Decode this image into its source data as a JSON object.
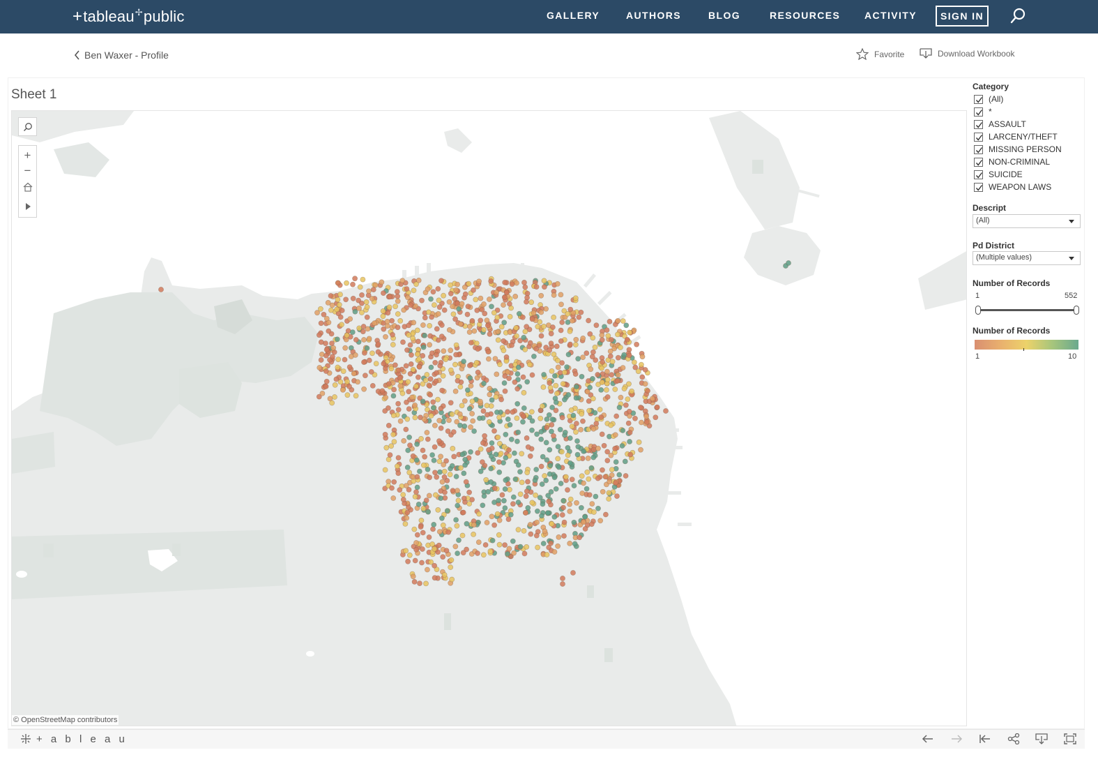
{
  "nav": {
    "logo": "tableau",
    "logo_suffix": "public",
    "items": [
      "GALLERY",
      "AUTHORS",
      "BLOG",
      "RESOURCES",
      "ACTIVITY"
    ],
    "sign_in": "SIGN IN"
  },
  "subheader": {
    "back_label": "Ben Waxer - Profile",
    "favorite_label": "Favorite",
    "download_label": "Download Workbook"
  },
  "sheet": {
    "title": "Sheet 1",
    "attribution": "© OpenStreetMap contributors"
  },
  "filters": {
    "category": {
      "title": "Category",
      "options": [
        "(All)",
        "*",
        "ASSAULT",
        "LARCENY/THEFT",
        "MISSING PERSON",
        "NON-CRIMINAL",
        "SUICIDE",
        "WEAPON LAWS"
      ],
      "checked": [
        true,
        true,
        true,
        true,
        true,
        true,
        true,
        true
      ]
    },
    "descript": {
      "title": "Descript",
      "value": "(All)"
    },
    "pd_district": {
      "title": "Pd District",
      "value": "(Multiple values)"
    },
    "records_range": {
      "title": "Number of Records",
      "min": "1",
      "max": "552",
      "low": 1,
      "high": 552
    },
    "color_legend": {
      "title": "Number of Records",
      "min": "1",
      "max": "10"
    }
  },
  "colors": {
    "nav_bg": "#2c4a66",
    "point_low": "#d17a5c",
    "point_mid": "#e8c460",
    "point_high": "#5f9e86",
    "land": "#e9ebea",
    "park": "#d9e0dc"
  },
  "icons": {
    "map_search": "search-icon",
    "zoom_in": "plus-icon",
    "zoom_out": "minus-icon",
    "home": "home-icon",
    "expand": "play-icon",
    "undo": "undo-icon",
    "redo": "redo-icon",
    "revert": "revert-icon",
    "share": "share-icon",
    "download": "download-icon",
    "fullscreen": "fullscreen-icon"
  },
  "footer": {
    "logo": "+ a b l e a u"
  }
}
